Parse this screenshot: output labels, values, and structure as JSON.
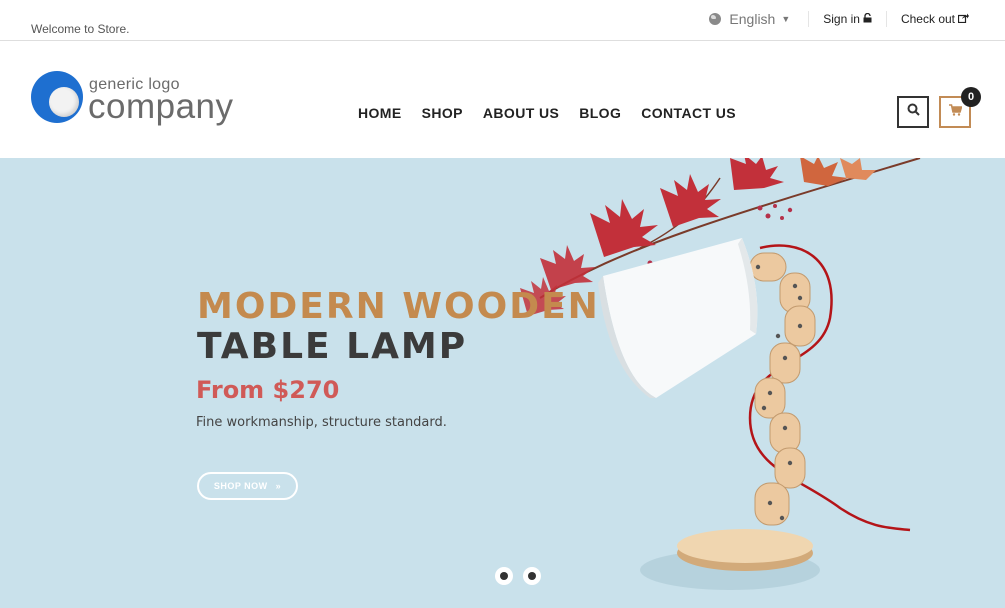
{
  "topbar": {
    "welcome": "Welcome to Store.",
    "language": "English",
    "language_icon": "globe-icon",
    "sign_in": "Sign in",
    "sign_in_icon": "unlock-icon",
    "check_out": "Check out",
    "check_out_icon": "share-icon"
  },
  "logo": {
    "small": "generic logo",
    "big": "company"
  },
  "nav": {
    "items": [
      "HOME",
      "SHOP",
      "ABOUT US",
      "BLOG",
      "CONTACT US"
    ]
  },
  "header": {
    "search_icon": "search-icon",
    "cart_icon": "cart-icon",
    "cart_count": "0"
  },
  "hero": {
    "title_line1": "MODERN WOODEN",
    "title_line2": "TABLE LAMP",
    "price": "From $270",
    "description": "Fine workmanship, structure standard.",
    "button": "SHOP NOW",
    "button_icon": "chevron-right-icon",
    "slides": 2
  },
  "colors": {
    "accent": "#c48a4e",
    "price": "#d05a57",
    "hero_bg": "#c9e1eb",
    "logo_blue": "#1e6fd0"
  }
}
